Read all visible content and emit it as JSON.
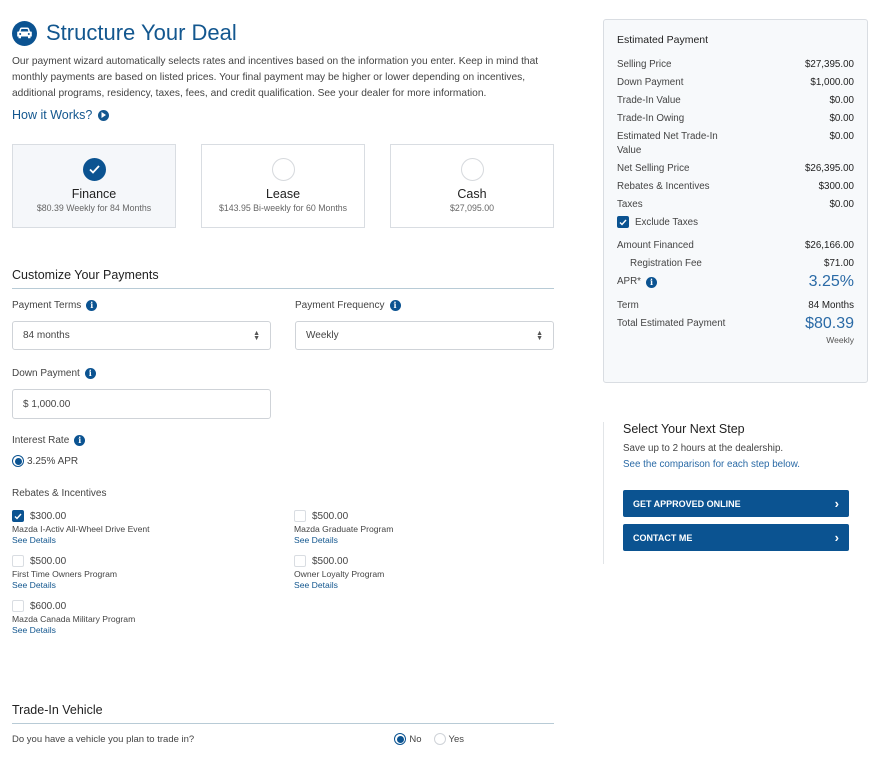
{
  "header": {
    "title": "Structure Your Deal",
    "intro": "Our payment wizard automatically selects rates and incentives based on the information you enter. Keep in mind that monthly payments are based on listed prices. Your final payment may be higher or lower depending on incentives, additional programs, residency, taxes, fees, and credit qualification. See your dealer for more information.",
    "how_it_works": "How it Works?"
  },
  "payment_types": [
    {
      "name": "Finance",
      "sub": "$80.39 Weekly for 84 Months",
      "selected": true
    },
    {
      "name": "Lease",
      "sub": "$143.95 Bi-weekly for 60 Months",
      "selected": false
    },
    {
      "name": "Cash",
      "sub": "$27,095.00",
      "selected": false
    }
  ],
  "customize": {
    "title": "Customize Your Payments",
    "terms_label": "Payment Terms",
    "terms_value": "84 months",
    "frequency_label": "Payment Frequency",
    "frequency_value": "Weekly",
    "down_label": "Down Payment",
    "down_value": "$ 1,000.00",
    "rate_label": "Interest Rate",
    "rate_option": "3.25% APR"
  },
  "rebates": {
    "title": "Rebates & Incentives",
    "see_details": "See Details",
    "items": [
      {
        "amount": "$300.00",
        "name": "Mazda I-Activ All-Wheel Drive Event",
        "checked": true
      },
      {
        "amount": "$500.00",
        "name": "Mazda Graduate Program",
        "checked": false
      },
      {
        "amount": "$500.00",
        "name": "First Time Owners Program",
        "checked": false
      },
      {
        "amount": "$500.00",
        "name": "Owner Loyalty Program",
        "checked": false
      },
      {
        "amount": "$600.00",
        "name": "Mazda Canada Military Program",
        "checked": false
      }
    ]
  },
  "trade_in": {
    "title": "Trade-In Vehicle",
    "question": "Do you have a vehicle you plan to trade in?",
    "no": "No",
    "yes": "Yes",
    "selected": "No"
  },
  "estimate": {
    "title": "Estimated Payment",
    "selling_price_label": "Selling Price",
    "selling_price": "$27,395.00",
    "down_payment_label": "Down Payment",
    "down_payment": "$1,000.00",
    "trade_value_label": "Trade-In Value",
    "trade_value": "$0.00",
    "trade_owing_label": "Trade-In Owing",
    "trade_owing": "$0.00",
    "net_trade_label": "Estimated Net Trade-In Value",
    "net_trade": "$0.00",
    "net_selling_label": "Net Selling Price",
    "net_selling": "$26,395.00",
    "rebates_label": "Rebates & Incentives",
    "rebates": "$300.00",
    "taxes_label": "Taxes",
    "taxes": "$0.00",
    "exclude_taxes_label": "Exclude Taxes",
    "amount_financed_label": "Amount Financed",
    "amount_financed": "$26,166.00",
    "registration_label": "Registration Fee",
    "registration": "$71.00",
    "apr_label": "APR*",
    "apr": "3.25%",
    "term_label": "Term",
    "term": "84 Months",
    "total_label": "Total Estimated Payment",
    "total": "$80.39",
    "frequency": "Weekly"
  },
  "next_step": {
    "title": "Select Your Next Step",
    "subtitle": "Save up to 2 hours at the dealership.",
    "link": "See the comparison for each step below.",
    "buttons": [
      "GET APPROVED ONLINE",
      "CONTACT ME"
    ]
  },
  "colors": {
    "brand": "#0b5391",
    "accent_text": "#2a6aa6"
  }
}
